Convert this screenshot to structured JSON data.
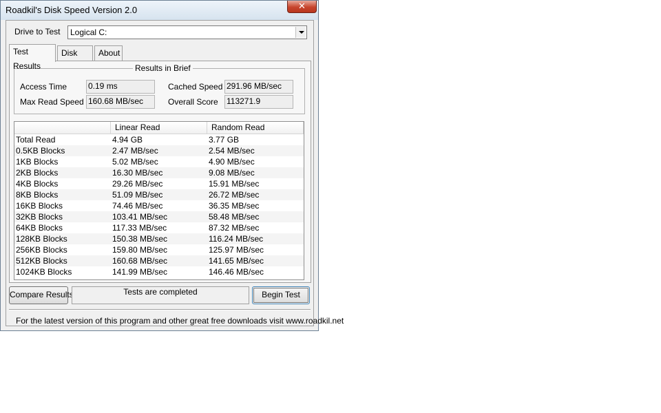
{
  "window": {
    "title": "Roadkil's Disk Speed Version 2.0",
    "close_glyph": "✕"
  },
  "drive": {
    "label": "Drive to Test",
    "value": "Logical C:"
  },
  "tabs": [
    {
      "label": "Test Results",
      "active": true
    },
    {
      "label": "Disk Info",
      "active": false
    },
    {
      "label": "About",
      "active": false
    }
  ],
  "brief": {
    "title": "Results in Brief",
    "access_time_label": "Access Time",
    "access_time_value": "0.19 ms",
    "cached_speed_label": "Cached Speed",
    "cached_speed_value": "291.96 MB/sec",
    "max_read_label": "Max Read Speed",
    "max_read_value": "160.68 MB/sec",
    "overall_score_label": "Overall Score",
    "overall_score_value": "113271.9"
  },
  "table": {
    "headers": [
      "",
      "Linear Read",
      "Random Read"
    ],
    "rows": [
      [
        "Total Read",
        "4.94 GB",
        "3.77 GB"
      ],
      [
        "0.5KB Blocks",
        "2.47 MB/sec",
        "2.54 MB/sec"
      ],
      [
        "1KB Blocks",
        "5.02 MB/sec",
        "4.90 MB/sec"
      ],
      [
        "2KB Blocks",
        "16.30 MB/sec",
        "9.08 MB/sec"
      ],
      [
        "4KB Blocks",
        "29.26 MB/sec",
        "15.91 MB/sec"
      ],
      [
        "8KB Blocks",
        "51.09 MB/sec",
        "26.72 MB/sec"
      ],
      [
        "16KB Blocks",
        "74.46 MB/sec",
        "36.35 MB/sec"
      ],
      [
        "32KB Blocks",
        "103.41 MB/sec",
        "58.48 MB/sec"
      ],
      [
        "64KB Blocks",
        "117.33 MB/sec",
        "87.32 MB/sec"
      ],
      [
        "128KB Blocks",
        "150.38 MB/sec",
        "116.24 MB/sec"
      ],
      [
        "256KB Blocks",
        "159.80 MB/sec",
        "125.97 MB/sec"
      ],
      [
        "512KB Blocks",
        "160.68 MB/sec",
        "141.65 MB/sec"
      ],
      [
        "1024KB Blocks",
        "141.99 MB/sec",
        "146.46 MB/sec"
      ]
    ]
  },
  "actions": {
    "compare_label": "Compare Results",
    "status_text": "Tests are completed",
    "begin_label": "Begin Test"
  },
  "footer": {
    "text": "For the latest version of this program and other great free downloads visit www.roadkil.net"
  }
}
